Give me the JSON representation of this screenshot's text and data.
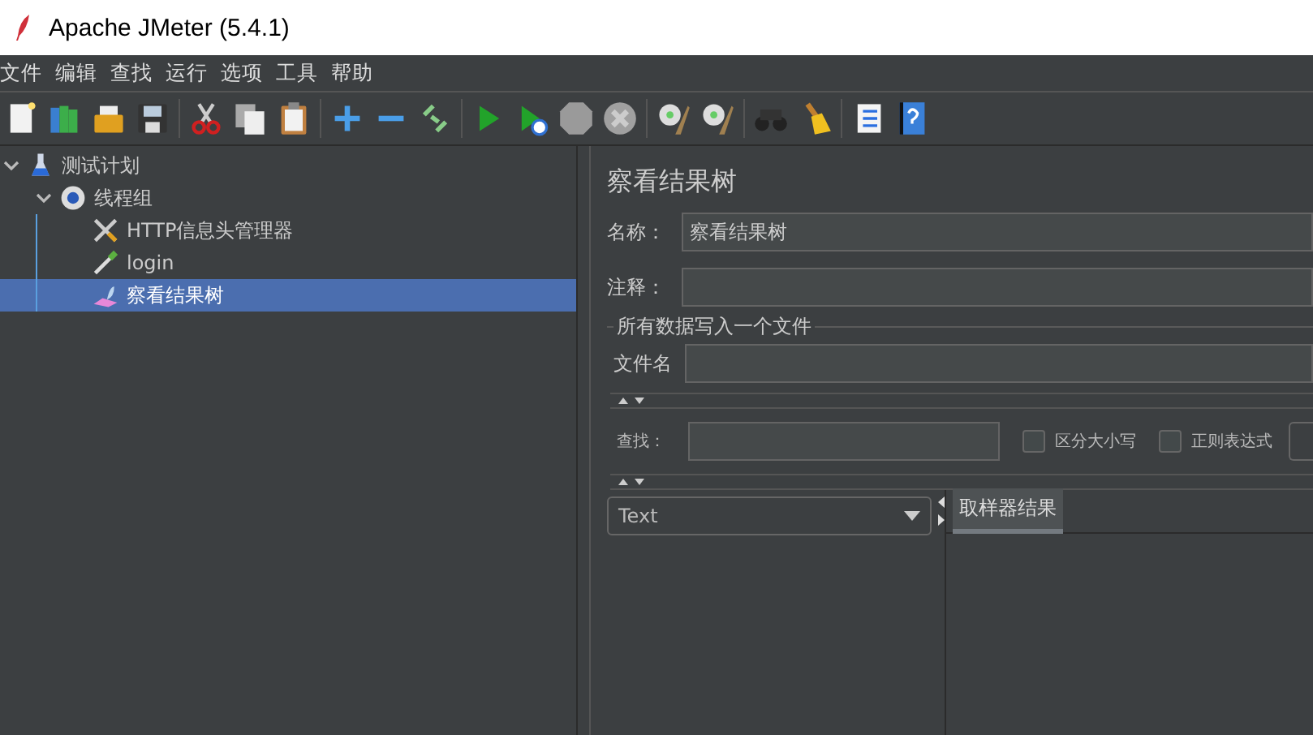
{
  "window": {
    "title": "Apache JMeter (5.4.1)"
  },
  "menu": [
    "文件",
    "编辑",
    "查找",
    "运行",
    "选项",
    "工具",
    "帮助"
  ],
  "tree": [
    {
      "label": "测试计划",
      "expanded": true,
      "selected": false,
      "children": [
        {
          "label": "线程组",
          "expanded": true,
          "selected": false,
          "children": [
            {
              "label": "HTTP信息头管理器",
              "selected": false
            },
            {
              "label": "login",
              "selected": false
            },
            {
              "label": "察看结果树",
              "selected": true
            }
          ]
        }
      ]
    }
  ],
  "panel": {
    "title": "察看结果树",
    "name_label": "名称：",
    "name_value": "察看结果树",
    "comment_label": "注释：",
    "group_title": "所有数据写入一个文件",
    "file_label": "文件名",
    "search_label": "查找：",
    "options": [
      {
        "label": "区分大小写",
        "checked": false
      },
      {
        "label": "正则表达式",
        "checked": false
      }
    ],
    "renderer": "Text",
    "tabs": [
      {
        "label": "取样器结果",
        "selected": true
      }
    ]
  }
}
